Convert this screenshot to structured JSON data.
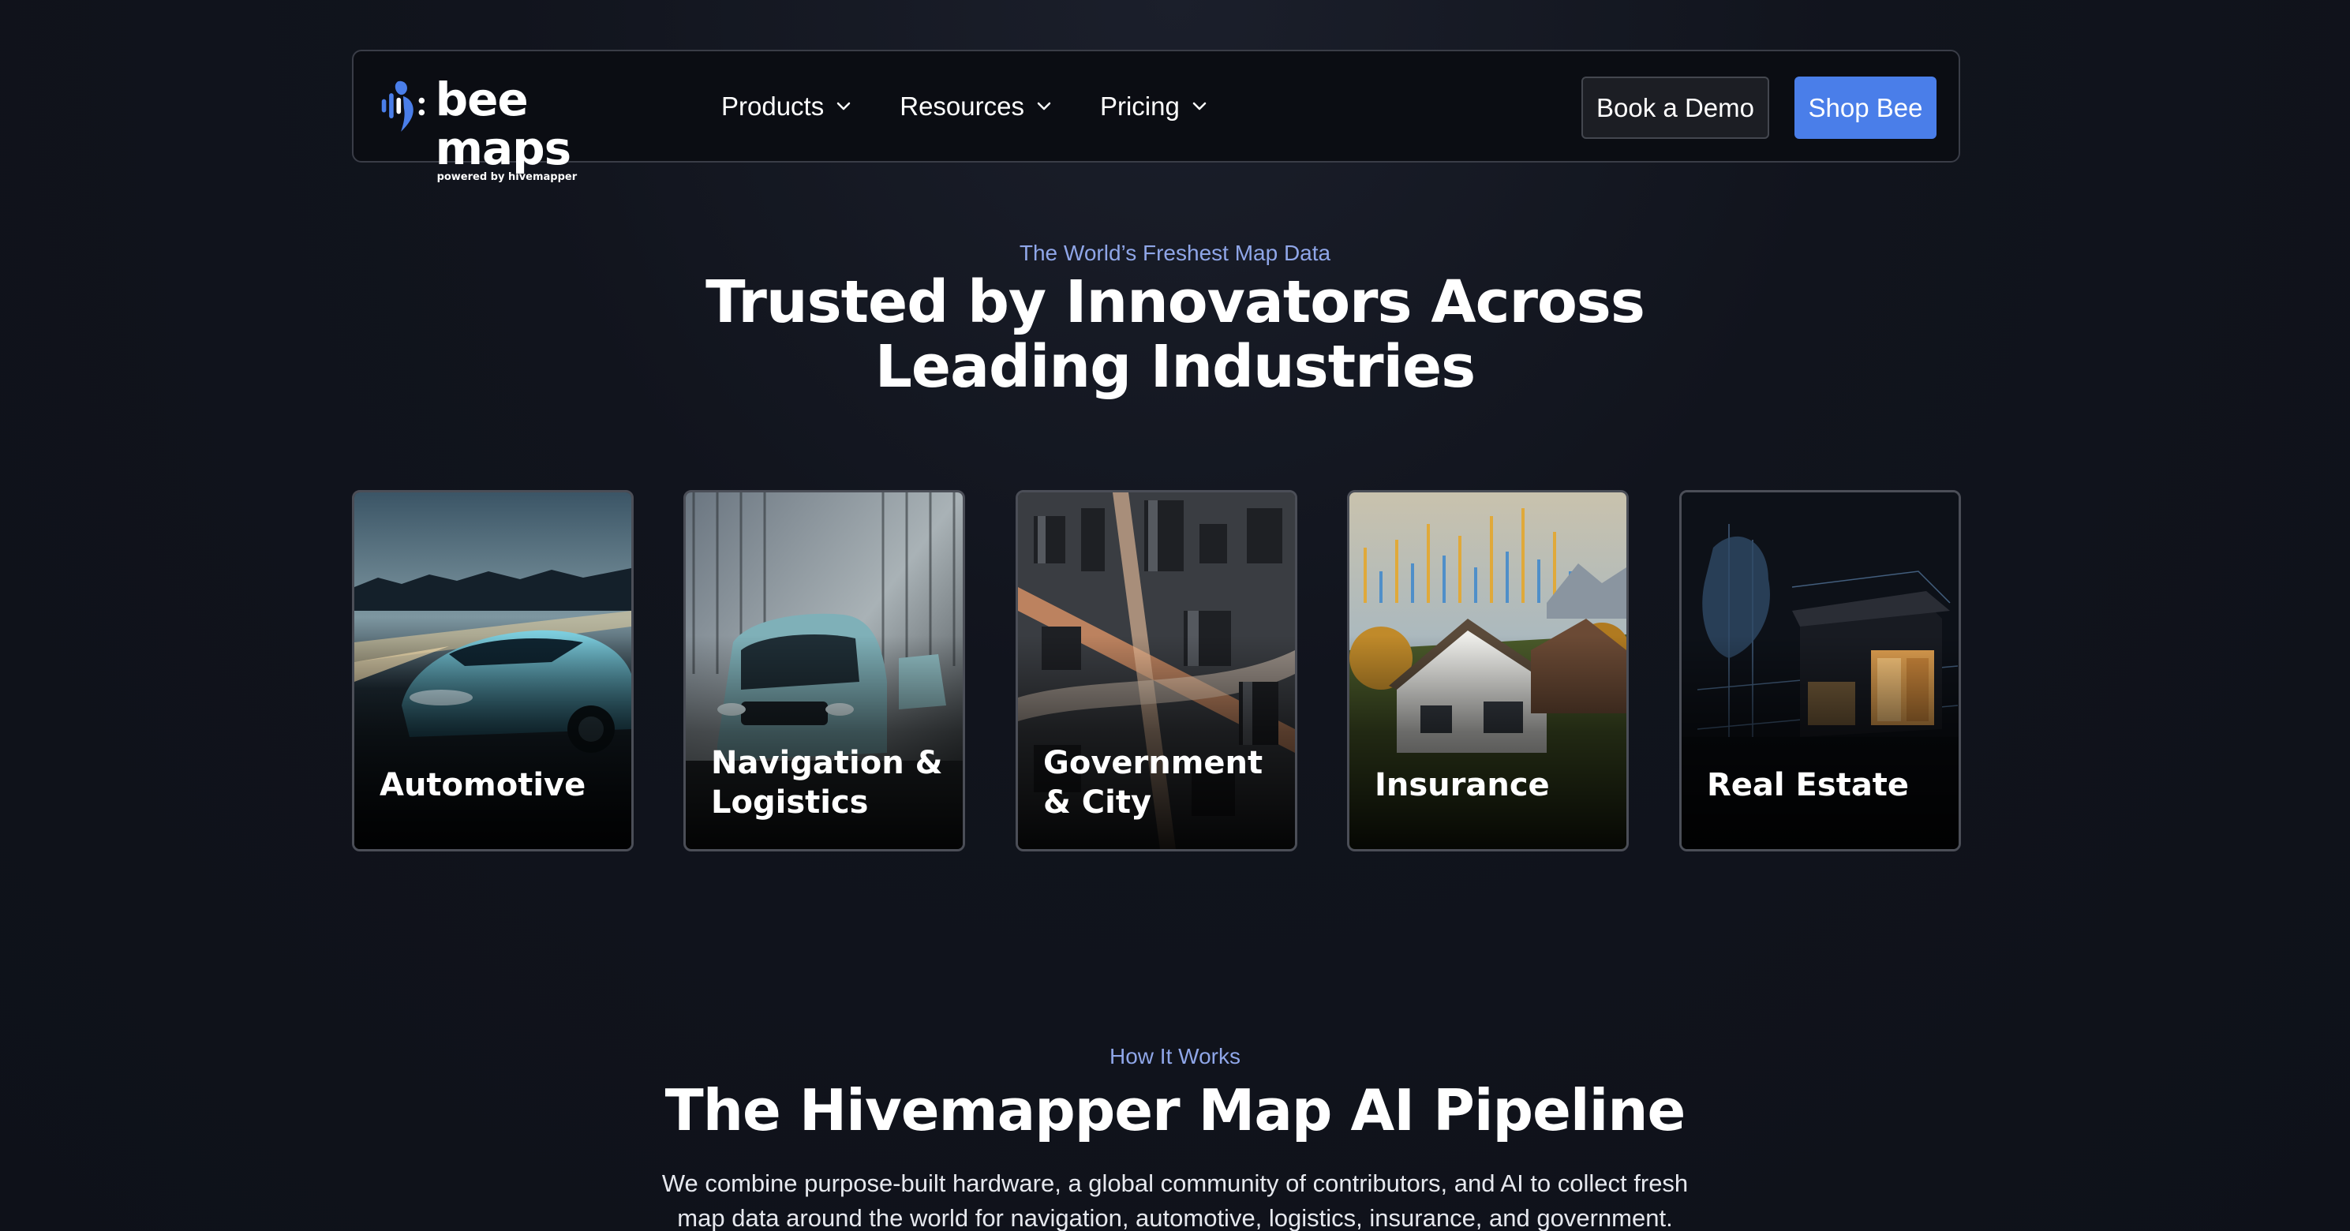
{
  "brand": {
    "name": "bee maps",
    "tagline": "powered by hivemapper",
    "accent": "#4a7ee9"
  },
  "nav": {
    "items": [
      {
        "label": "Products",
        "icon": "chevron-down-icon"
      },
      {
        "label": "Resources",
        "icon": "chevron-down-icon"
      },
      {
        "label": "Pricing",
        "icon": "chevron-down-icon"
      }
    ],
    "demo_label": "Book a Demo",
    "shop_label": "Shop Bee"
  },
  "hero": {
    "eyebrow": "The World’s Freshest Map Data",
    "title_line1": "Trusted by Innovators Across",
    "title_line2": "Leading Industries"
  },
  "industries": [
    {
      "label": "Automotive"
    },
    {
      "label": "Navigation & Logistics"
    },
    {
      "label": "Government & City"
    },
    {
      "label": "Insurance"
    },
    {
      "label": "Real Estate"
    }
  ],
  "how": {
    "eyebrow": "How It Works",
    "title": "The Hivemapper Map AI Pipeline",
    "description_line1": "We combine purpose-built hardware, a global community of contributors, and AI to collect fresh",
    "description_line2": "map data around the world for navigation, automotive, logistics, insurance, and government."
  }
}
